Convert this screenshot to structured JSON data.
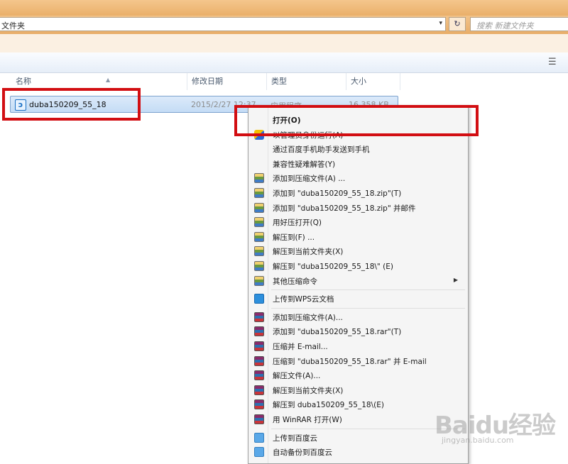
{
  "address_bar": {
    "path": "文件夹",
    "dropdown": "▾",
    "refresh": "↻",
    "search_placeholder": "搜索 新建文件夹"
  },
  "toolbar": {
    "view_icon": "view-toggle-icon"
  },
  "columns": [
    "名称",
    "修改日期",
    "类型",
    "大小"
  ],
  "file": {
    "name": "duba150209_55_18",
    "date": "2015/2/27 12:37",
    "type": "应用程序",
    "size": "16,358 KB"
  },
  "context_menu": {
    "items": [
      {
        "label": "打开(O)",
        "icon": "",
        "bold": true
      },
      {
        "label": "以管理员身份运行(A)",
        "icon": "shield"
      },
      {
        "label": "通过百度手机助手发送到手机",
        "icon": ""
      },
      {
        "label": "兼容性疑难解答(Y)",
        "icon": ""
      },
      {
        "label": "添加到压缩文件(A) ...",
        "icon": "zip"
      },
      {
        "label": "添加到 \"duba150209_55_18.zip\"(T)",
        "icon": "zip"
      },
      {
        "label": "添加到 \"duba150209_55_18.zip\" 并邮件",
        "icon": "zip"
      },
      {
        "label": "用好压打开(Q)",
        "icon": "zip"
      },
      {
        "label": "解压到(F) ...",
        "icon": "zip"
      },
      {
        "label": "解压到当前文件夹(X)",
        "icon": "zip"
      },
      {
        "label": "解压到 \"duba150209_55_18\\\" (E)",
        "icon": "zip"
      },
      {
        "label": "其他压缩命令",
        "icon": "zip",
        "submenu": true
      },
      {
        "label": "上传到WPS云文档",
        "icon": "wps",
        "sep_before": true
      },
      {
        "label": "添加到压缩文件(A)...",
        "icon": "rar",
        "sep_before": true
      },
      {
        "label": "添加到 \"duba150209_55_18.rar\"(T)",
        "icon": "rar"
      },
      {
        "label": "压缩并 E-mail...",
        "icon": "rar"
      },
      {
        "label": "压缩到 \"duba150209_55_18.rar\" 并 E-mail",
        "icon": "rar"
      },
      {
        "label": "解压文件(A)...",
        "icon": "rar"
      },
      {
        "label": "解压到当前文件夹(X)",
        "icon": "rar"
      },
      {
        "label": "解压到 duba150209_55_18\\(E)",
        "icon": "rar"
      },
      {
        "label": "用 WinRAR 打开(W)",
        "icon": "rar"
      },
      {
        "label": "上传到百度云",
        "icon": "bdy",
        "sep_before": true
      },
      {
        "label": "自动备份到百度云",
        "icon": "bdy"
      }
    ]
  },
  "watermark": {
    "brand": "Baidu经验",
    "sub": "jingyan.baidu.com"
  }
}
